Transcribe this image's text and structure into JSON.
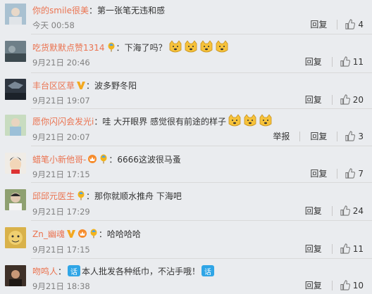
{
  "labels": {
    "reply": "回复",
    "report": "举报"
  },
  "comments": [
    {
      "user": "你的smile很美",
      "colon": "：",
      "text": "第一张笔无违和感",
      "time": "今天 00:58",
      "likes": "4",
      "avatar_color": "#7fa0b8"
    },
    {
      "user": "吃货默默点赞1314",
      "colon": "：",
      "text": "下海了吗？",
      "time": "9月21日 20:46",
      "likes": "11",
      "avatar_color": "#5a6b73"
    },
    {
      "user": "丰台区区草",
      "colon": "：",
      "text": "波多野冬阳",
      "time": "9月21日 19:07",
      "likes": "20",
      "avatar_color": "#3a4450"
    },
    {
      "user": "愿你闪闪会发光i",
      "colon": "：",
      "text": "哇 大开眼界  感觉很有前途的样子",
      "time": "9月21日 20:07",
      "likes": "3",
      "avatar_color": "#a8c9a0"
    },
    {
      "user": "蜡笔小新他哥-",
      "colon": "：",
      "text": "6666这波很马蚤",
      "time": "9月21日 17:15",
      "likes": "7",
      "avatar_color": "#d8d0c8"
    },
    {
      "user": "邱邱元医生",
      "colon": "：",
      "text": "那你就顺水推舟 下海吧",
      "time": "9月21日 17:29",
      "likes": "24",
      "avatar_color": "#6b7c5a"
    },
    {
      "user": "Zn_幽魂",
      "colon": "：",
      "text": "哈哈哈哈",
      "time": "9月21日 17:15",
      "likes": "11",
      "avatar_color": "#c8a850"
    },
    {
      "user": "吻鸣人",
      "colon": "：",
      "text": "本人批发各种纸巾，不沾手哦！",
      "tag": "话",
      "time": "9月21日 18:38",
      "likes": "10",
      "avatar_color": "#4a3a30"
    }
  ]
}
